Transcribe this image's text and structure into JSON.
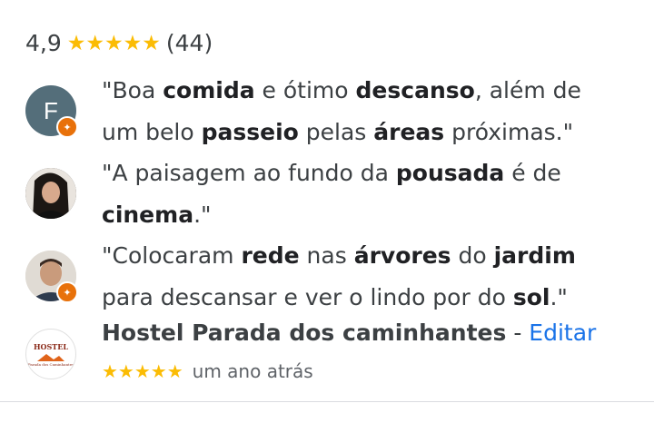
{
  "summary": {
    "rating": "4,9",
    "stars": "★★★★★",
    "count": "(44)"
  },
  "reviews": [
    {
      "avatar_letter": "F",
      "parts": [
        {
          "t": "\"Boa ",
          "b": false
        },
        {
          "t": "comida",
          "b": true
        },
        {
          "t": " e ótimo ",
          "b": false
        },
        {
          "t": "descanso",
          "b": true
        },
        {
          "t": ", além de",
          "b": false
        },
        {
          "t": "\n",
          "b": false
        },
        {
          "t": "um belo ",
          "b": false
        },
        {
          "t": "passeio",
          "b": true
        },
        {
          "t": " pelas ",
          "b": false
        },
        {
          "t": "áreas",
          "b": true
        },
        {
          "t": " próximas.\"",
          "b": false
        }
      ]
    },
    {
      "parts": [
        {
          "t": "\"A paisagem ao fundo da ",
          "b": false
        },
        {
          "t": "pousada",
          "b": true
        },
        {
          "t": " é de",
          "b": false
        },
        {
          "t": "\n",
          "b": false
        },
        {
          "t": "cinema",
          "b": true
        },
        {
          "t": ".\"",
          "b": false
        }
      ]
    },
    {
      "parts": [
        {
          "t": "\"Colocaram ",
          "b": false
        },
        {
          "t": "rede",
          "b": true
        },
        {
          "t": " nas ",
          "b": false
        },
        {
          "t": "árvores",
          "b": true
        },
        {
          "t": " do ",
          "b": false
        },
        {
          "t": "jardim",
          "b": true
        },
        {
          "t": "\n",
          "b": false
        },
        {
          "t": "para descansar e ver o lindo por do ",
          "b": false
        },
        {
          "t": "sol",
          "b": true
        },
        {
          "t": ".\"",
          "b": false
        }
      ]
    }
  ],
  "place": {
    "logo_text": "HOSTEL",
    "logo_subtext": "Parada dos Caminhantes",
    "name": "Hostel Parada dos caminhantes",
    "separator": " - ",
    "edit_label": "Editar",
    "stars": "★★★★★",
    "time": "um ano atrás"
  },
  "colors": {
    "star": "#fbbc04",
    "link": "#1a73e8",
    "badge": "#e8710a",
    "avatar_f": "#546e7a"
  }
}
